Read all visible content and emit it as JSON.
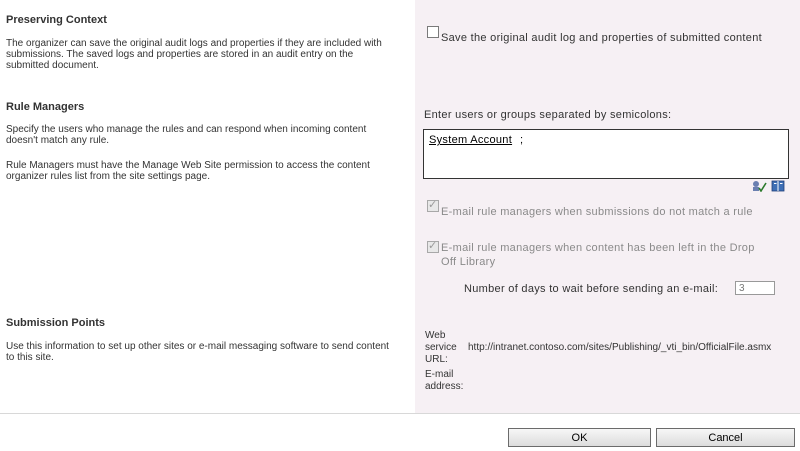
{
  "preserving": {
    "title": "Preserving Context",
    "desc_line1": "The organizer can save the original audit logs and properties if they are included with",
    "desc_line2": "submissions.  The saved logs and properties are stored in an audit entry on the",
    "desc_line3": "submitted document.",
    "checkbox_label": "Save the original audit log and properties of submitted content"
  },
  "rule_managers": {
    "title": "Rule Managers",
    "desc1_line1": "Specify the users who manage the rules and can respond when incoming content",
    "desc1_line2": "doesn't match any rule.",
    "desc2_line1": "Rule Managers must have the Manage Web Site permission to access the content",
    "desc2_line2": "organizer rules list from the site settings page.",
    "people_prompt": "Enter users or groups separated by semicolons:",
    "people_value": "System Account",
    "people_sep": ";",
    "email_nomatch_label": "E-mail rule managers when submissions do not match a rule",
    "email_dropoff_line1": "E-mail rule managers when content has been left in the Drop",
    "email_dropoff_line2": "Off Library",
    "days_label": "Number of days to wait before sending an e-mail:",
    "days_value": "3"
  },
  "submission": {
    "title": "Submission Points",
    "desc_line1": "Use this information to set up other sites or e-mail messaging software to send content",
    "desc_line2": "to this site.",
    "ws_line1": "Web",
    "ws_line2": "service",
    "ws_line3": "URL:",
    "ws_url": "http://intranet.contoso.com/sites/Publishing/_vti_bin/OfficialFile.asmx",
    "email_line1": "E-mail",
    "email_line2": "address:"
  },
  "buttons": {
    "ok": "OK",
    "cancel": "Cancel"
  },
  "icons": {
    "check_names": "check-names-icon",
    "browse": "address-book-icon"
  }
}
